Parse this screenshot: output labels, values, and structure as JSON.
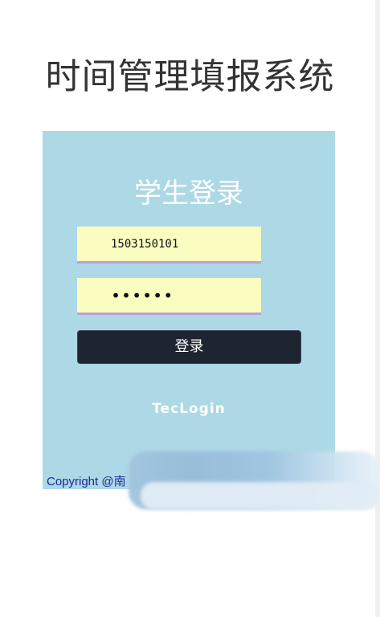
{
  "header": {
    "title": "时间管理填报系统"
  },
  "login": {
    "title": "学生登录",
    "username_value": "1503150101",
    "password_value": "••••••",
    "submit_label": "登录",
    "alt_login_link": "TecLogin"
  },
  "footer": {
    "copyright": "Copyright @南"
  },
  "colors": {
    "panel_bg": "#add8e6",
    "input_bg": "#fafcc0",
    "input_underline": "#b6a2dc",
    "button_bg": "#1e2430",
    "copyright_text": "#1a2a9a"
  }
}
